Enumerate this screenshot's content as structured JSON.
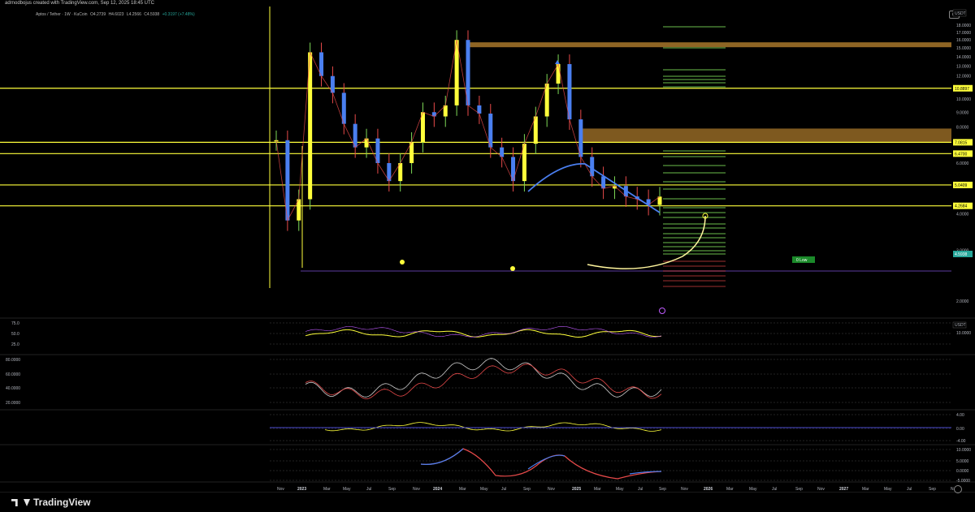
{
  "header": {
    "credit": "adrnodbojus created with TradingView.com, Sep 12, 2025 18:45 UTC",
    "symbol_title": "Aptos / Tether · 1W · KuCoin",
    "ohlc": [
      "O4.2739",
      "H4.6023",
      "L4.2566",
      "C4.5938",
      "+0.3197 (+7.48%)"
    ]
  },
  "footer": {
    "brand": "TradingView"
  },
  "colors": {
    "bg": "#000000",
    "level": "#ffff3b",
    "zone": "#a8772a",
    "up": "#7ed957",
    "down": "#e84a4a",
    "blue": "#4a7ff0"
  },
  "icons": [
    "camera-icon",
    "tradingview-logo-icon",
    "settings-gear-icon"
  ],
  "chart_data": [
    {
      "type": "line",
      "title": "Aptos / Tether · 1W · KuCoin",
      "scale": "log",
      "yaxis_unit": "USDT",
      "y_ticks": [
        2.0,
        3.0,
        4.0,
        5.0,
        6.0,
        7.0,
        8.0,
        9.0,
        10.0,
        11.0,
        12.0,
        13.0,
        14.0,
        15.0,
        16.0,
        17.0,
        18.0
      ],
      "y_tick_labels": [
        "2.0000",
        "3.0000",
        "4.0000",
        "5.0000",
        "6.0000",
        "7.0000",
        "8.0000",
        "9.0000",
        "10.0000",
        "11.0000",
        "12.0000",
        "13.0000",
        "14.0000",
        "15.0000",
        "16.0000",
        "17.0000",
        "18.0000"
      ],
      "x_ticks": [
        "Nov",
        "2023",
        "Mar",
        "May",
        "Jul",
        "Sep",
        "Nov",
        "2024",
        "Mar",
        "May",
        "Jul",
        "Sep",
        "Nov",
        "2025",
        "Mar",
        "May",
        "Jul",
        "Sep",
        "Nov",
        "2026",
        "Mar",
        "May",
        "Jul",
        "Sep",
        "Nov",
        "2027",
        "Mar",
        "May",
        "Jul",
        "Sep",
        "N"
      ],
      "x": [
        "Oct 2022",
        "Nov 2022",
        "Jan 2023",
        "Feb 2023",
        "Mar 2023",
        "Apr 2023",
        "May 2023",
        "Jun 2023",
        "Jul 2023",
        "Aug 2023",
        "Sep 2023",
        "Oct 2023",
        "Nov 2023",
        "Dec 2023",
        "Jan 2024",
        "Feb 2024",
        "Mar 2024",
        "Apr 2024",
        "May 2024",
        "Jun 2024",
        "Jul 2024",
        "Aug 2024",
        "Sep 2024",
        "Oct 2024",
        "Nov 2024",
        "Dec 2024",
        "Jan 2025",
        "Feb 2025",
        "Mar 2025",
        "Apr 2025",
        "May 2025",
        "Jun 2025",
        "Jul 2025",
        "Aug 2025",
        "Sep 2025"
      ],
      "series": [
        {
          "values": [
            7.2,
            3.8,
            4.5,
            14.5,
            12.0,
            10.5,
            8.2,
            6.8,
            7.3,
            6.0,
            5.2,
            6.0,
            7.1,
            9.0,
            8.7,
            9.5,
            16.0,
            9.5,
            8.9,
            6.8,
            6.3,
            5.2,
            7.0,
            8.7,
            11.3,
            13.2,
            8.5,
            6.3,
            5.4,
            4.9,
            5.0,
            4.6,
            4.5,
            4.3,
            4.5938
          ]
        }
      ],
      "horizontal_levels": [
        10.8897,
        7.0815,
        6.47,
        5.0409,
        4.2684
      ],
      "level_labels": [
        "10.8897",
        "7.0815",
        "6.4700",
        "5.0409",
        "4.2684"
      ],
      "price_label": "4.5938",
      "marker_label": "0 Low",
      "zones": [
        [
          15.1,
          15.7
        ],
        [
          7.1,
          7.9
        ]
      ]
    },
    {
      "type": "line",
      "panel": "oscillator 1",
      "y_ticks": [
        "75.0",
        "50.0",
        "25.0"
      ],
      "right_label": "USDT",
      "right_value": "10.0000"
    },
    {
      "type": "area",
      "panel": "oscillator 2",
      "y_ticks": [
        "80.0000",
        "60.0000",
        "40.0000",
        "20.0000"
      ]
    },
    {
      "type": "line",
      "panel": "oscillator 3",
      "y_ticks": [
        "4.00",
        "0.00",
        "-4.00"
      ]
    },
    {
      "type": "line",
      "panel": "oscillator 4",
      "y_ticks": [
        "10.0000",
        "5.0000",
        "0.0000",
        "-5.0000"
      ]
    }
  ]
}
